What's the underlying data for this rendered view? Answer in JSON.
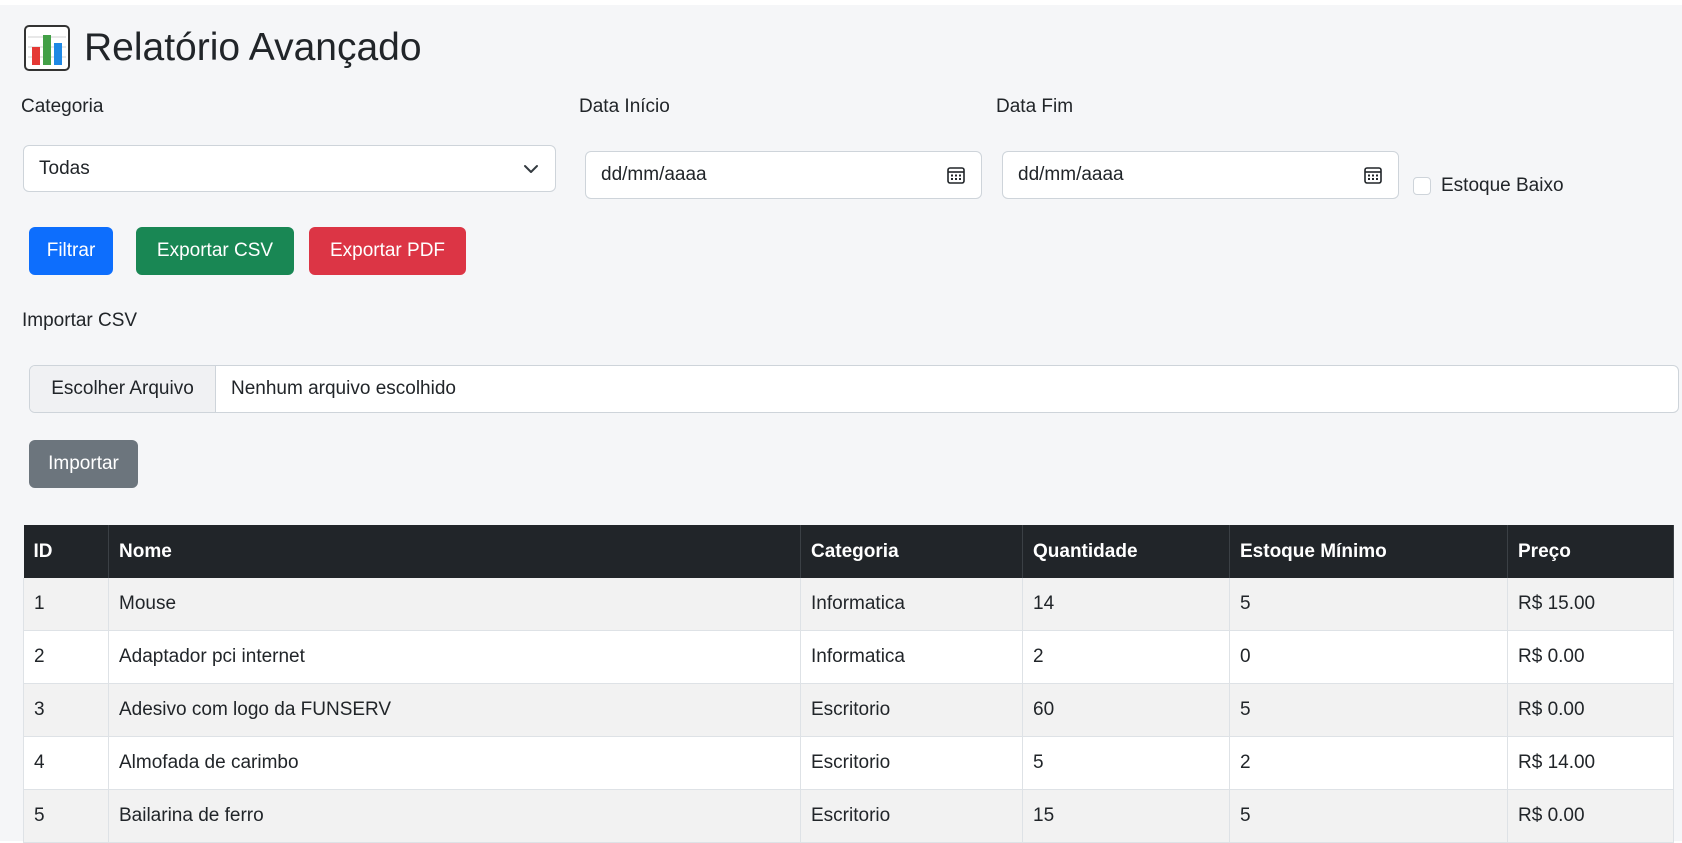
{
  "header": {
    "title": "Relatório Avançado",
    "icon": "bar-chart-icon"
  },
  "filters": {
    "category_label": "Categoria",
    "category_value": "Todas",
    "start_label": "Data Início",
    "start_placeholder": "dd/mm/aaaa",
    "end_label": "Data Fim",
    "end_placeholder": "dd/mm/aaaa",
    "low_stock_label": "Estoque Baixo",
    "low_stock_checked": false
  },
  "actions": {
    "filter_label": "Filtrar",
    "export_csv_label": "Exportar CSV",
    "export_pdf_label": "Exportar PDF"
  },
  "import": {
    "label": "Importar CSV",
    "choose_label": "Escolher Arquivo",
    "no_file_text": "Nenhum arquivo escolhido",
    "import_label": "Importar"
  },
  "table": {
    "columns": [
      "ID",
      "Nome",
      "Categoria",
      "Quantidade",
      "Estoque Mínimo",
      "Preço"
    ],
    "rows": [
      [
        "1",
        "Mouse",
        "Informatica",
        "14",
        "5",
        "R$ 15.00"
      ],
      [
        "2",
        "Adaptador pci internet",
        "Informatica",
        "2",
        "0",
        "R$ 0.00"
      ],
      [
        "3",
        "Adesivo com logo da FUNSERV",
        "Escritorio",
        "60",
        "5",
        "R$ 0.00"
      ],
      [
        "4",
        "Almofada de carimbo",
        "Escritorio",
        "5",
        "2",
        "R$ 14.00"
      ],
      [
        "5",
        "Bailarina de ferro",
        "Escritorio",
        "15",
        "5",
        "R$ 0.00"
      ]
    ]
  },
  "colors": {
    "primary": "#0d6efd",
    "success": "#198754",
    "danger": "#dc3545",
    "secondary": "#6c757d",
    "table_header": "#212529"
  }
}
